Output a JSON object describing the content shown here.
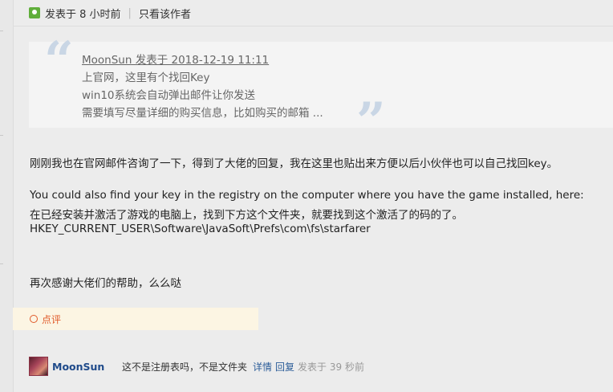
{
  "post_meta": {
    "posted_label": "发表于 8 小时前",
    "separator": "|",
    "only_author_link": "只看该作者"
  },
  "quote": {
    "author_line": "MoonSun 发表于 2018-12-19 11:11",
    "lines": [
      "上官网，这里有个找回Key",
      "win10系统会自动弹出邮件让你发送",
      "需要填写尽量详细的购买信息，比如购买的邮箱 ..."
    ]
  },
  "post": {
    "lines": [
      "刚刚我也在官网邮件咨询了一下，得到了大佬的回复，我在这里也贴出来方便以后小伙伴也可以自己找回key。",
      "You could also find your key in the registry on the computer where you have the game installed, here:",
      "在已经安装并激活了游戏的电脑上，找到下方这个文件夹，就要找到这个激活了的码的了。",
      "HKEY_CURRENT_USER\\Software\\JavaSoft\\Prefs\\com\\fs\\starfarer",
      "再次感谢大佬们的帮助，么么哒"
    ]
  },
  "comment_bar": {
    "label": "点评"
  },
  "reply": {
    "username": "MoonSun",
    "text": "这不是注册表吗，不是文件夹",
    "details_link": "详情",
    "reply_link": "回复",
    "time": "发表于 39 秒前"
  },
  "colors": {
    "background": "#ececec",
    "quote_background": "#f4f4f4",
    "quote_mark": "#c9d6e5",
    "comment_bar_background": "#fcf5e3",
    "comment_accent": "#e05a2a",
    "link_blue": "#2c5d99",
    "online_green": "#5fae3a"
  },
  "icons": {
    "online": "online-status-icon",
    "comment": "comment-circle-icon",
    "quote_open": "open-quote-icon",
    "quote_close": "close-quote-icon"
  }
}
